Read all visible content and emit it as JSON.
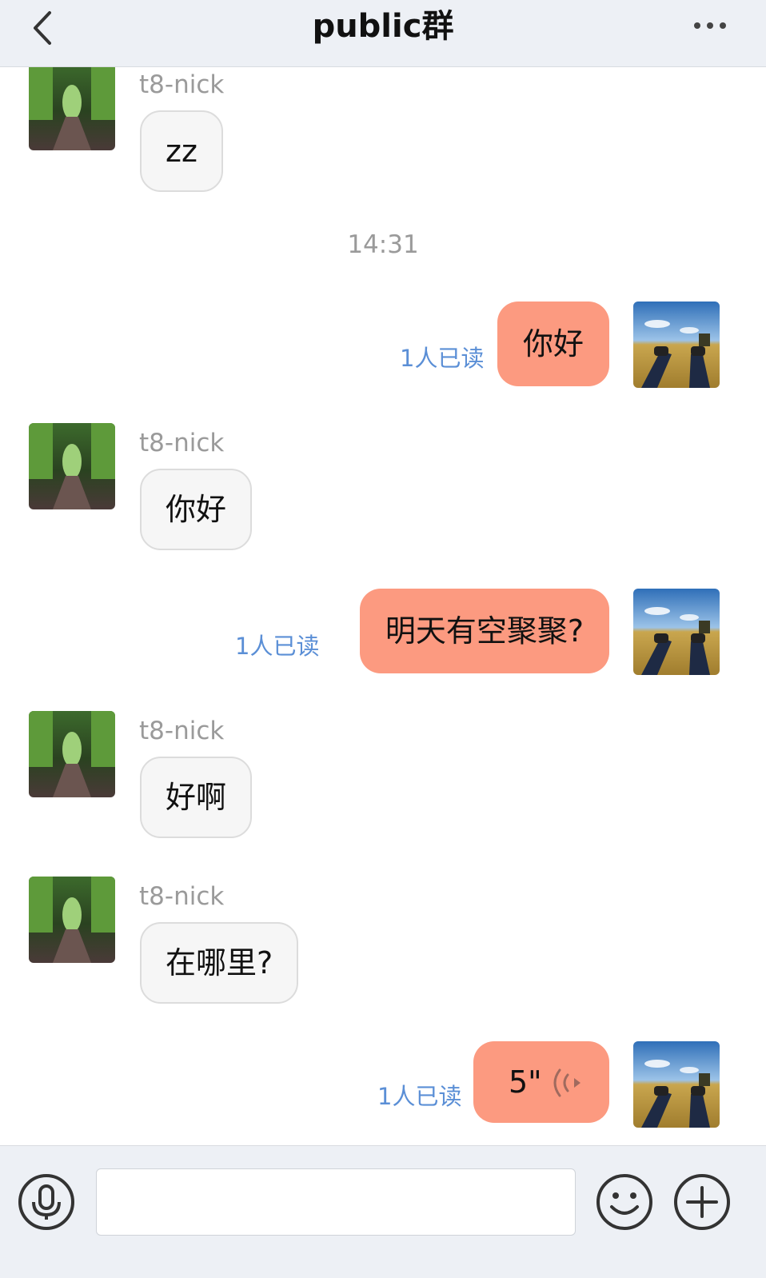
{
  "header": {
    "title": "public群",
    "back_icon": "chevron-left-icon",
    "more_icon": "more-dots-icon"
  },
  "messages": [
    {
      "side": "in",
      "nick": "t8-nick",
      "text": "zz"
    },
    {
      "timestamp": "14:31"
    },
    {
      "side": "out",
      "text": "你好",
      "read_status": "1人已读"
    },
    {
      "side": "in",
      "nick": "t8-nick",
      "text": "你好"
    },
    {
      "side": "out",
      "text": "明天有空聚聚?",
      "read_status": "1人已读"
    },
    {
      "side": "in",
      "nick": "t8-nick",
      "text": "好啊"
    },
    {
      "side": "in",
      "nick": "t8-nick",
      "text": "在哪里?"
    },
    {
      "side": "out",
      "voice_duration": "5\"",
      "read_status": "1人已读"
    }
  ],
  "composer": {
    "input_value": "",
    "voice_icon": "microphone-icon",
    "emoji_icon": "smiley-icon",
    "add_icon": "plus-circle-icon"
  },
  "colors": {
    "header_bg": "#edf0f5",
    "outgoing_bubble": "#fc9a80",
    "incoming_bubble": "#f6f6f6",
    "read_status": "#5b8fd6"
  }
}
